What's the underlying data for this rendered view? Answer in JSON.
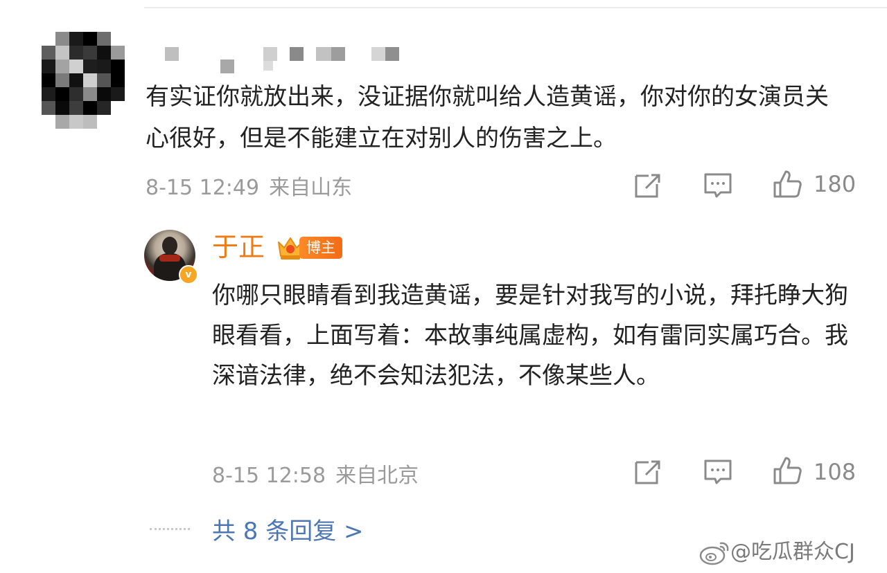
{
  "main_comment": {
    "text": "有实证你就放出来，没证据你就叫给人造黄谣，你对你的女演员关心很好，但是不能建立在对别人的伤害之上。",
    "date": "8-15 12:49",
    "location": "来自山东",
    "likes": "180"
  },
  "reply": {
    "author": "于正",
    "badge": "博主",
    "verify_mark": "v",
    "text": "你哪只眼睛看到我造黄谣，要是针对我写的小说，拜托睁大狗眼看看，上面写着：本故事纯属虚构，如有雷同实属巧合。我深谙法律，绝不会知法犯法，不像某些人。",
    "date": "8-15 12:58",
    "location": "来自北京",
    "likes": "108"
  },
  "more_replies": "共 8 条回复 >",
  "watermark": "@吃瓜群众CJ",
  "colors": {
    "username_orange": "#ef7b12",
    "link_blue": "#4d77b2",
    "meta_gray": "#9a9a9a",
    "badge_orange": "#f36b16"
  },
  "icons": {
    "share": "share-edit-icon",
    "comment": "comment-bubble-icon",
    "like": "thumbs-up-icon",
    "weibo": "weibo-logo-icon"
  }
}
